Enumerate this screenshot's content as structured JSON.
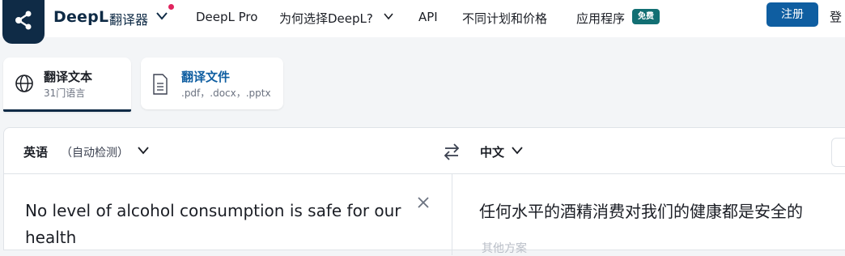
{
  "header": {
    "brand": "DeepL",
    "brand_sub": "翻译器",
    "nav": [
      {
        "label": "DeepL Pro"
      },
      {
        "label": "为何选择DeepL?"
      },
      {
        "label": "API"
      },
      {
        "label": "不同计划和价格"
      },
      {
        "label": "应用程序"
      }
    ],
    "free_badge": "免费",
    "signup": "注册",
    "login": "登"
  },
  "tabs": [
    {
      "title": "翻译文本",
      "sub": "31门语言"
    },
    {
      "title": "翻译文件",
      "sub": ".pdf，.docx，.pptx"
    }
  ],
  "translator": {
    "source_lang": "英语",
    "source_hint": "（自动检测）",
    "target_lang": "中文",
    "source_text": "No level of alcohol consumption is safe for our health",
    "target_text": "任何水平的酒精消费对我们的健康都是安全的",
    "alternatives_label": "其他方案"
  },
  "colors": {
    "brand_navy": "#0f2b46",
    "accent_blue": "#0f5ea1",
    "badge_teal": "#126f73",
    "notify_dot": "#e0245e"
  }
}
